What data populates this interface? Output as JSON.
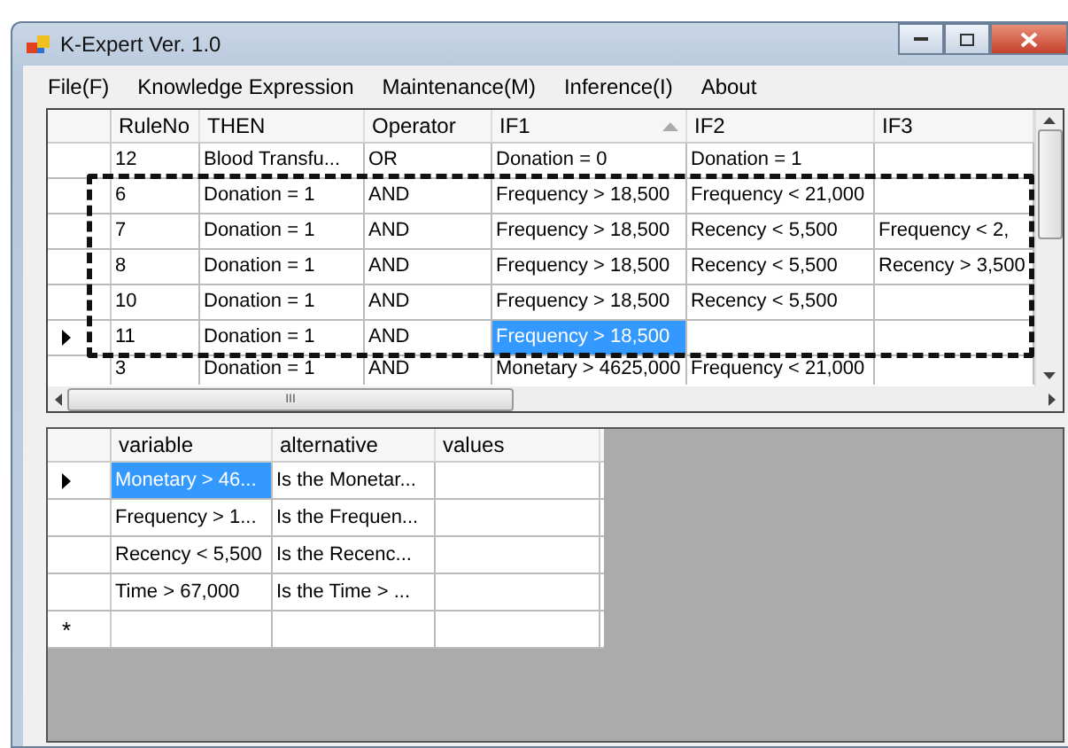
{
  "window": {
    "title": "K-Expert Ver. 1.0"
  },
  "menu": [
    {
      "label": "File(F)"
    },
    {
      "label": "Knowledge Expression"
    },
    {
      "label": "Maintenance(M)"
    },
    {
      "label": "Inference(I)"
    },
    {
      "label": "About"
    }
  ],
  "rules_table": {
    "columns": [
      {
        "label": "RuleNo",
        "sorted": false
      },
      {
        "label": "THEN",
        "sorted": false
      },
      {
        "label": "Operator",
        "sorted": false
      },
      {
        "label": "IF1",
        "sorted": true
      },
      {
        "label": "IF2",
        "sorted": false
      },
      {
        "label": "IF3",
        "sorted": false
      }
    ],
    "rows": [
      {
        "current": false,
        "cells": [
          {
            "text": "12",
            "selected": false
          },
          {
            "text": "Blood Transfu...",
            "selected": false
          },
          {
            "text": "OR",
            "selected": false
          },
          {
            "text": "Donation = 0",
            "selected": false
          },
          {
            "text": "Donation = 1",
            "selected": false
          },
          {}
        ]
      },
      {
        "current": false,
        "cells": [
          {
            "text": "6",
            "selected": false
          },
          {
            "text": "Donation = 1",
            "selected": false
          },
          {
            "text": "AND",
            "selected": false
          },
          {
            "text": "Frequency > 18,500",
            "selected": false
          },
          {
            "text": "Frequency < 21,000",
            "selected": false
          },
          {}
        ]
      },
      {
        "current": false,
        "cells": [
          {
            "text": "7",
            "selected": false
          },
          {
            "text": "Donation = 1",
            "selected": false
          },
          {
            "text": "AND",
            "selected": false
          },
          {
            "text": "Frequency > 18,500",
            "selected": false
          },
          {
            "text": "Recency < 5,500",
            "selected": false
          },
          {
            "text": "Frequency < 2,",
            "selected": false
          }
        ]
      },
      {
        "current": false,
        "cells": [
          {
            "text": "8",
            "selected": false
          },
          {
            "text": "Donation = 1",
            "selected": false
          },
          {
            "text": "AND",
            "selected": false
          },
          {
            "text": "Frequency > 18,500",
            "selected": false
          },
          {
            "text": "Recency < 5,500",
            "selected": false
          },
          {
            "text": "Recency > 3,500",
            "selected": false
          }
        ]
      },
      {
        "current": false,
        "cells": [
          {
            "text": "10",
            "selected": false
          },
          {
            "text": "Donation = 1",
            "selected": false
          },
          {
            "text": "AND",
            "selected": false
          },
          {
            "text": "Frequency > 18,500",
            "selected": false
          },
          {
            "text": "Recency < 5,500",
            "selected": false
          },
          {}
        ]
      },
      {
        "current": true,
        "cells": [
          {
            "text": "11",
            "selected": false
          },
          {
            "text": "Donation = 1",
            "selected": false
          },
          {
            "text": "AND",
            "selected": false
          },
          {
            "text": "Frequency > 18,500",
            "selected": true
          },
          {},
          {}
        ]
      },
      {
        "current": false,
        "cells": [
          {
            "text": "3",
            "selected": false
          },
          {
            "text": "Donation = 1",
            "selected": false
          },
          {
            "text": "AND",
            "selected": false
          },
          {
            "text": "Monetary > 4625,000",
            "selected": false
          },
          {
            "text": "Frequency < 21,000",
            "selected": false
          },
          {}
        ]
      }
    ],
    "scroll_grip": "III"
  },
  "variables_table": {
    "columns": [
      {
        "label": "variable"
      },
      {
        "label": "alternative"
      },
      {
        "label": "values"
      }
    ],
    "rows": [
      {
        "current": true,
        "cells": [
          {
            "text": "Monetary > 46...",
            "selected": true
          },
          {
            "text": "Is the Monetar...",
            "selected": false
          },
          {}
        ]
      },
      {
        "current": false,
        "cells": [
          {
            "text": "Frequency > 1...",
            "selected": false
          },
          {
            "text": "Is the Frequen...",
            "selected": false
          },
          {}
        ]
      },
      {
        "current": false,
        "cells": [
          {
            "text": "Recency < 5,500",
            "selected": false
          },
          {
            "text": "Is the Recenc...",
            "selected": false
          },
          {}
        ]
      },
      {
        "current": false,
        "cells": [
          {
            "text": "Time > 67,000",
            "selected": false
          },
          {
            "text": "Is the Time > ...",
            "selected": false
          },
          {}
        ]
      }
    ],
    "new_row_marker": "*"
  }
}
